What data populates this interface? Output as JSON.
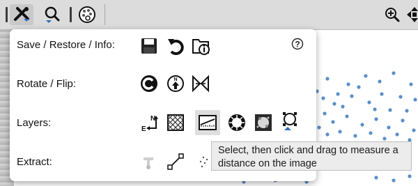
{
  "panel": {
    "help_symbol": "?",
    "rows": [
      {
        "label": "Save / Restore / Info:"
      },
      {
        "label": "Rotate / Flip:"
      },
      {
        "label": "Layers:"
      },
      {
        "label": "Extract:"
      }
    ]
  },
  "tooltip": {
    "line1": "Select, then click and drag to measure a",
    "line2": "distance on the image"
  },
  "icons": {
    "toolbar": [
      "tools-icon",
      "zoom-search-icon",
      "palette-icon",
      "zoom-in-icon",
      "pan-icon"
    ],
    "save_restore_info": [
      "save-icon",
      "restore-icon",
      "info-icon"
    ],
    "rotate_flip": [
      "rotate-icon",
      "north-up-icon",
      "flip-icon"
    ],
    "layers": [
      "north-east-arrows-icon",
      "grid-overlay-icon",
      "ruler-icon",
      "starburst-icon",
      "noise-icon",
      "annotation-node-icon"
    ],
    "extract": [
      "cursor-pointer-icon",
      "line-profile-icon",
      "point-cloud-icon"
    ]
  },
  "colors": {
    "dot_blue": "#5b8fc8",
    "dropdown_arrow": "#2f6fb8"
  }
}
